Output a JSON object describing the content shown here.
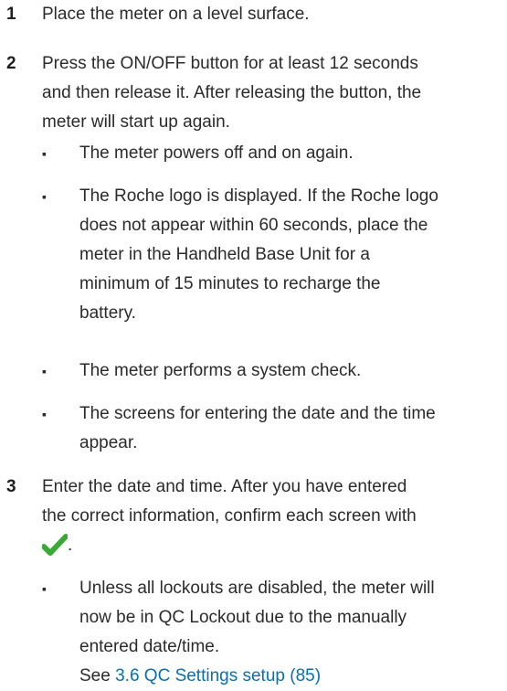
{
  "steps": [
    {
      "number": "1",
      "text": "Place the meter on a level surface."
    },
    {
      "number": "2",
      "text_lines": [
        "Press the ON/OFF button for at least 12 seconds",
        "and then release it. After releasing the button, the",
        "meter will start up again."
      ],
      "bullets": [
        {
          "lines": [
            "The meter powers off and on again."
          ]
        },
        {
          "lines": [
            "The Roche logo is displayed. If the Roche logo",
            "does not appear within 60 seconds, place the",
            "meter in the Handheld Base Unit for a",
            "minimum of 15 minutes to recharge the",
            "battery."
          ]
        },
        {
          "lines": [
            "The meter performs a system check."
          ]
        },
        {
          "lines": [
            "The screens for entering the date and the time",
            "appear."
          ]
        }
      ]
    },
    {
      "number": "3",
      "text_lines": [
        "Enter the date and time. After you have entered",
        "the correct information, confirm each screen with"
      ],
      "confirm_icon": "checkmark-icon",
      "confirm_suffix": ".",
      "bullets": [
        {
          "lines": [
            "Unless all lockouts are disabled, the meter will",
            "now be in QC Lockout due to the manually",
            "entered date/time."
          ],
          "see_prefix": "See ",
          "see_link": "3.6 QC Settings setup (85)"
        }
      ]
    }
  ],
  "bullet_glyph": "▪",
  "colors": {
    "text": "#2b2b2b",
    "link": "#0a6fb0",
    "check": "#3aa935"
  }
}
